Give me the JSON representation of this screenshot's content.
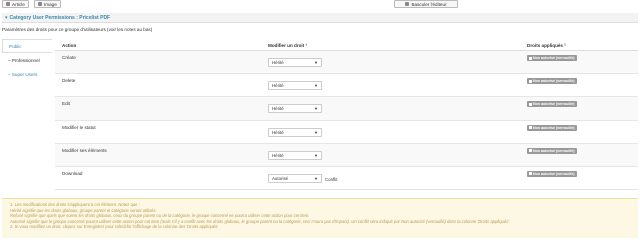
{
  "toolbar": {
    "article_label": "Article",
    "image_label": "Image",
    "toggle_editor_label": "Basculer l'éditeur"
  },
  "panel": {
    "title": "Category User Permissions : Pricelist PDF",
    "description": "Paramètres des droits pour ce groupe d'utilisateurs (voir les notes au bas)"
  },
  "groups": [
    {
      "label": "Public"
    },
    {
      "label": "– Professionnel"
    },
    {
      "label": "– Super Users"
    }
  ],
  "table": {
    "col_action": "Action",
    "col_change": "Modifier un droit ¹",
    "col_computed": "Droits appliqués ²",
    "rows": [
      {
        "action": "Créate",
        "select": "Hérité",
        "badge": "Non autorisé (verrouillé)"
      },
      {
        "action": "Delete",
        "select": "Hérité",
        "badge": "Non autorisé (verrouillé)"
      },
      {
        "action": "Edit",
        "select": "Hérité",
        "badge": "Non autorisé (verrouillé)"
      },
      {
        "action": "Modifier le statut",
        "select": "Hérité",
        "badge": "Non autorisé (verrouillé)"
      },
      {
        "action": "Modifier ses éléments",
        "select": "Hérité",
        "badge": "Non autorisé (verrouillé)"
      },
      {
        "action": "Download",
        "select": "Autorisé",
        "conflict": "Conflit",
        "badge": "Non autorisé (verrouillé)"
      }
    ]
  },
  "notes": [
    "1. Les modifications des droits s'appliquent à cet élément. Notez que :",
    "Hérité signifie que les droits globaux, groupe parent et catégorie seront utilisés.",
    "Refusé signifie que quels que soient les droits globaux, ceux du groupe parent ou de la catégorie, le groupe concerné ne pourra utiliser cette action pour cet item.",
    "Autorisé signifie que le groupe concerné pourra utiliser cette action pour cet item (mais s'il y a conflit avec les droits globaux, le groupe parent ou la catégorie, ceci n'aura pas d'impact). Un conflit sera indiqué par Non autorisé (verrouillé) dans la colonne 'Droits appliqués'.",
    "2. Si vous modifiez un droit, cliquez sur Enregistrer pour rafraîchir l'affichage de la colonne des 'Droits appliqués'."
  ],
  "colors": {
    "accent": "#3a87ad",
    "badge": "#999999",
    "notes_bg": "#fcf8e3"
  }
}
